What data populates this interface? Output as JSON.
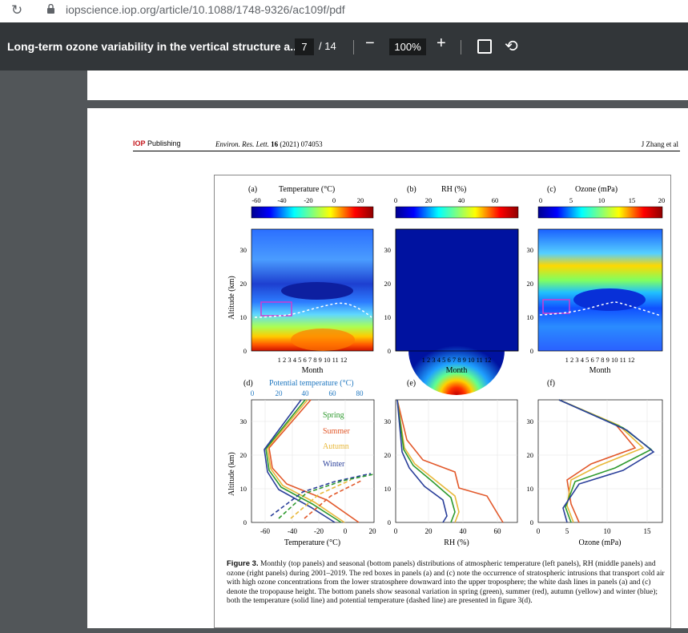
{
  "browser": {
    "url": "iopscience.iop.org/article/10.1088/1748-9326/ac109f/pdf"
  },
  "viewer": {
    "doc_title": "Long-term ozone variability in the vertical structure a...",
    "page_current": "7",
    "page_total": "/ 14",
    "zoom": "100%"
  },
  "page": {
    "publisher_bold": "IOP",
    "publisher_rest": " Publishing",
    "journal_italic": "Environ. Res. Lett.",
    "journal_vol": "16",
    "journal_rest": "(2021) 074053",
    "authors": "J Zhang et al"
  },
  "figure": {
    "panels": {
      "a": {
        "label": "(a)",
        "title": "Temperature (°C)",
        "ticks": [
          "-60",
          "-40",
          "-20",
          "0",
          "20"
        ]
      },
      "b": {
        "label": "(b)",
        "title": "RH (%)",
        "ticks": [
          "0",
          "20",
          "40",
          "60"
        ]
      },
      "c": {
        "label": "(c)",
        "title": "Ozone (mPa)",
        "ticks": [
          "0",
          "5",
          "10",
          "15",
          "20"
        ]
      },
      "d": {
        "label": "(d)",
        "title": "Potential temperature (°C)",
        "ticks": [
          "0",
          "20",
          "40",
          "60",
          "80"
        ]
      },
      "e": {
        "label": "(e)"
      },
      "f": {
        "label": "(f)"
      }
    },
    "ylabel": "Altitude (km)",
    "yticks": [
      "0",
      "10",
      "20",
      "30"
    ],
    "month_ticks": "1 2 3 4 5 6 7 8 9 10 11 12",
    "month_label": "Month",
    "bottom_xlabels": [
      "Temperature (°C)",
      "RH (%)",
      "Ozone (mPa)"
    ],
    "d_xticks": [
      "-60",
      "-40",
      "-20",
      "0",
      "20"
    ],
    "e_xticks": [
      "0",
      "20",
      "40",
      "60"
    ],
    "f_xticks": [
      "0",
      "5",
      "10",
      "15"
    ],
    "legend": [
      {
        "name": "Spring",
        "color": "#2e9a2e"
      },
      {
        "name": "Summer",
        "color": "#e2582a"
      },
      {
        "name": "Autumn",
        "color": "#e8b83a"
      },
      {
        "name": "Winter",
        "color": "#2a3f9a"
      }
    ]
  },
  "caption": {
    "label": "Figure 3.",
    "text": " Monthly (top panels) and seasonal (bottom panels) distributions of atmospheric temperature (left panels), RH (middle panels) and ozone (right panels) during 2001–2019. The red boxes in panels (a) and (c) note the occurrence of stratospheric intrusions that transport cold air with high ozone concentrations from the lower stratosphere downward into the upper troposphere; the white dash lines in panels (a) and (c) denote the tropopause height. The bottom panels show seasonal variation in spring (green), summer (red), autumn (yellow) and winter (blue); both the temperature (solid line) and potential temperature (dashed line) are presented in figure 3(d)."
  }
}
